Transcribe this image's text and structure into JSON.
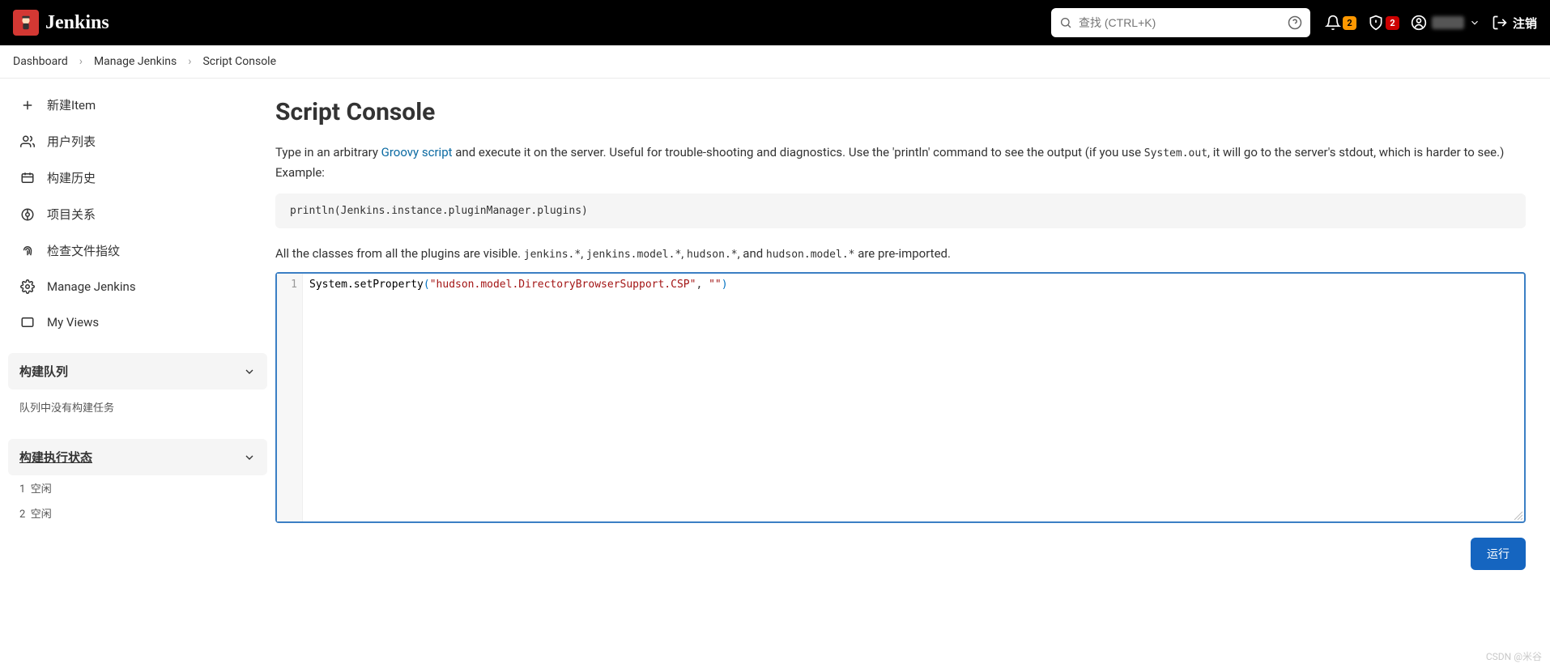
{
  "header": {
    "brand": "Jenkins",
    "search_placeholder": "查找 (CTRL+K)",
    "notif_badge": "2",
    "security_badge": "2",
    "logout_label": "注销"
  },
  "breadcrumbs": {
    "items": [
      "Dashboard",
      "Manage Jenkins",
      "Script Console"
    ]
  },
  "sidebar": {
    "items": [
      {
        "icon": "plus",
        "label": "新建Item"
      },
      {
        "icon": "users",
        "label": "用户列表"
      },
      {
        "icon": "history",
        "label": "构建历史"
      },
      {
        "icon": "relation",
        "label": "项目关系"
      },
      {
        "icon": "fingerprint",
        "label": "检查文件指纹"
      },
      {
        "icon": "gear",
        "label": "Manage Jenkins"
      },
      {
        "icon": "views",
        "label": "My Views"
      }
    ],
    "queue_title": "构建队列",
    "queue_empty": "队列中没有构建任务",
    "exec_title": "构建执行状态",
    "executors": [
      {
        "num": "1",
        "status": "空闲"
      },
      {
        "num": "2",
        "status": "空闲"
      }
    ]
  },
  "page": {
    "title": "Script Console",
    "intro_pre": "Type in an arbitrary ",
    "intro_link": "Groovy script",
    "intro_post_1": " and execute it on the server. Useful for trouble-shooting and diagnostics. Use the 'println' command to see the output (if you use ",
    "intro_code": "System.out",
    "intro_post_2": ", it will go to the server's stdout, which is harder to see.) Example:",
    "example_code": "println(Jenkins.instance.pluginManager.plugins)",
    "plugins_pre": "All the classes from all the plugins are visible. ",
    "plugins_c1": "jenkins.*",
    "plugins_c2": "jenkins.model.*",
    "plugins_c3": "hudson.*",
    "plugins_post_mid": ", and ",
    "plugins_c4": "hudson.model.*",
    "plugins_post": " are pre-imported.",
    "editor_line_num": "1",
    "editor_fn": "System.setProperty",
    "editor_str1": "\"hudson.model.DirectoryBrowserSupport.CSP\"",
    "editor_comma": ", ",
    "editor_str2": "\"\"",
    "run_label": "运行"
  },
  "watermark": "CSDN @米谷"
}
